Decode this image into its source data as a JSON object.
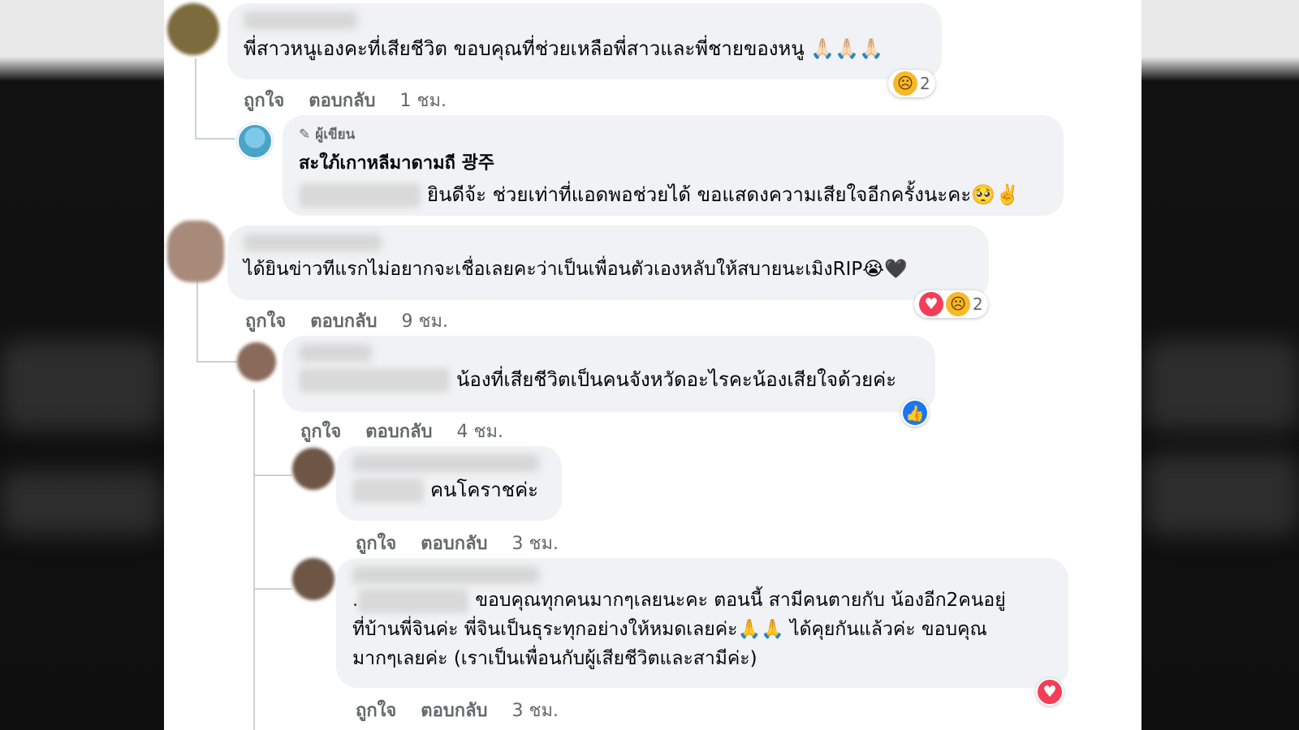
{
  "comments": [
    {
      "text": "พี่สาวหนูเองคะที่เสียชีวิต ขอบคุณที่ช่วยเหลือพี่สาวและพี่ชายของหนู 🙏🏻🙏🏻🙏🏻",
      "actions": {
        "like": "ถูกใจ",
        "reply": "ตอบกลับ",
        "time": "1 ชม."
      },
      "reaction": {
        "icons": [
          "sad-reaction-icon"
        ],
        "count": "2"
      }
    },
    {
      "author_badge": "ผู้เขียน",
      "page_name": "สะใภ้เกาหลีมาดามถี 광주",
      "text": "ยินดีจ้ะ ช่วยเท่าที่แอดพอช่วยได้ ขอแสดงความเสียใจอีกครั้งนะคะ🥺✌️"
    },
    {
      "text": "ได้ยินข่าวทีแรกไม่อยากจะเชื่อเลยคะว่าเป็นเพื่อนตัวเองหลับให้สบายนะเมิงRIP😭🖤",
      "actions": {
        "like": "ถูกใจ",
        "reply": "ตอบกลับ",
        "time": "9 ชม."
      },
      "reaction": {
        "icons": [
          "love-reaction-icon",
          "sad-reaction-icon"
        ],
        "count": "2"
      }
    },
    {
      "text": "น้องที่เสียชีวิตเป็นคนจังหวัดอะไรคะน้องเสียใจด้วยค่ะ",
      "actions": {
        "like": "ถูกใจ",
        "reply": "ตอบกลับ",
        "time": "4 ชม."
      },
      "reaction": {
        "icons": [
          "like-reaction-icon"
        ]
      }
    },
    {
      "text": "คนโคราชค่ะ",
      "actions": {
        "like": "ถูกใจ",
        "reply": "ตอบกลับ",
        "time": "3 ชม."
      }
    },
    {
      "line1": "ขอบคุณทุกคนมากๆเลยนะคะ ตอนนี้ สามีคนตายกับ น้องอีก2คนอยู่",
      "line2": "ที่บ้านพี่จินค่ะ พี่จินเป็นธุระทุกอย่างให้หมดเลยค่ะ🙏🙏 ได้คุยกันแล้วค่ะ ขอบคุณ",
      "line3": "มากๆเลยค่ะ (เราเป็นเพื่อนกับผู้เสียชีวิตและสามีค่ะ)",
      "actions": {
        "like": "ถูกใจ",
        "reply": "ตอบกลับ",
        "time": "3 ชม."
      },
      "reaction": {
        "icons": [
          "love-reaction-icon"
        ]
      }
    }
  ],
  "colors": {
    "bubble": "#f0f2f5",
    "meta": "#65676b",
    "text": "#050505",
    "like": "#1877f2",
    "love": "#f33e58",
    "sad": "#f7b928"
  }
}
